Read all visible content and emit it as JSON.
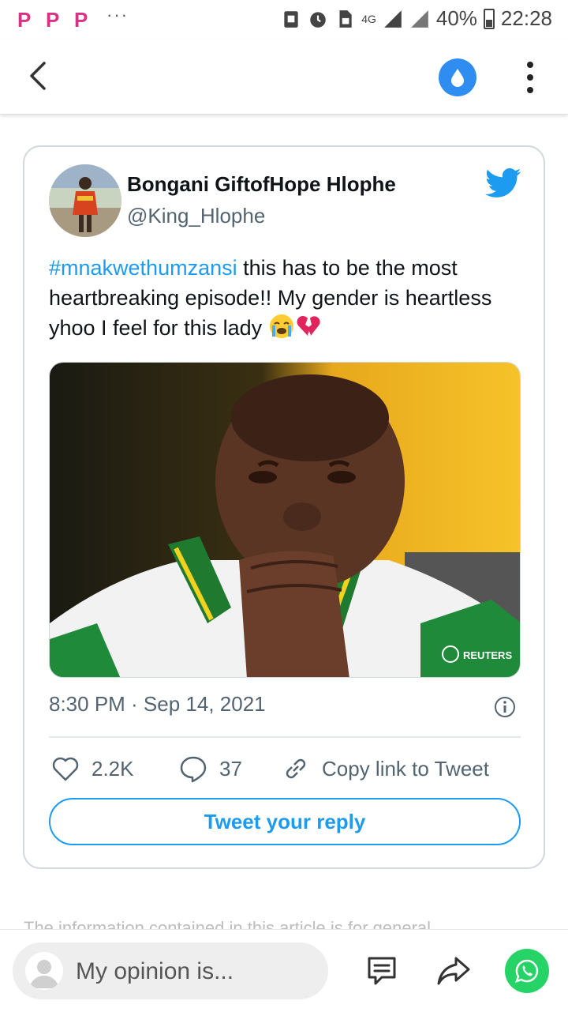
{
  "status_bar": {
    "app_letters": [
      "P",
      "P",
      "P"
    ],
    "overflow": "···",
    "network": "4G",
    "battery": "40%",
    "time": "22:28"
  },
  "tweet": {
    "author_name": "Bongani GiftofHope Hlophe",
    "handle": "@King_Hlophe",
    "hashtag": "#mnakwethumzansi",
    "body": " this has to be the most heartbreaking episode!! My gender is heartless yhoo I feel for this lady ",
    "media_watermark": "REUTERS",
    "timestamp": "8:30 PM · Sep 14, 2021",
    "likes": "2.2K",
    "replies": "37",
    "copy_link_label": "Copy link to Tweet",
    "reply_button_label": "Tweet your reply"
  },
  "article_snippet": "The information contained in this article is for general",
  "bottom_bar": {
    "comment_placeholder": "My opinion is..."
  },
  "colors": {
    "twitter_blue": "#1d9bf0",
    "drop_button": "#2f8cf0",
    "whatsapp_green": "#25d366",
    "status_app_pink": "#d63384"
  }
}
